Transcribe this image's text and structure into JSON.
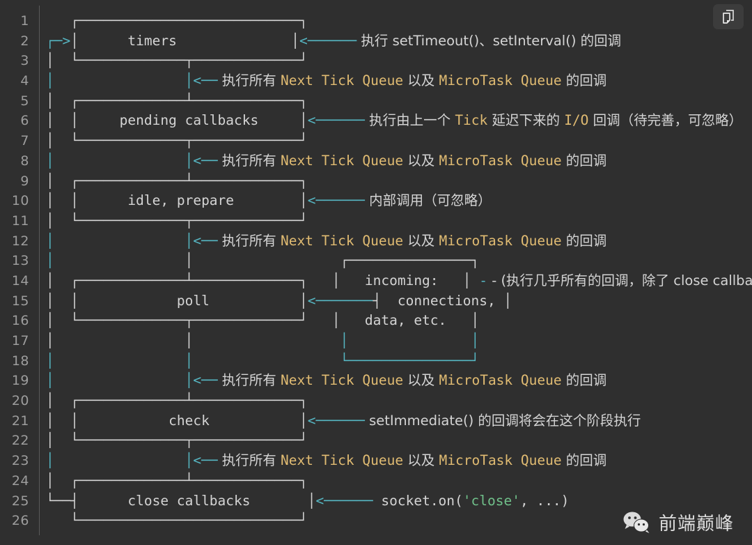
{
  "window": {
    "background": "#2f2f2f",
    "foreground": "#d4d4d4",
    "accent_teal": "#56b6c2",
    "accent_yellow": "#e0bb72",
    "accent_green": "#70c08a",
    "gutter_color": "#9d9d9d"
  },
  "toolbar": {
    "copy_label": "copy-code"
  },
  "gutter": {
    "line_numbers": [
      "1",
      "2",
      "3",
      "4",
      "5",
      "6",
      "7",
      "8",
      "9",
      "10",
      "11",
      "12",
      "13",
      "14",
      "15",
      "16",
      "17",
      "18",
      "19",
      "20",
      "21",
      "22",
      "23",
      "24",
      "25",
      "26"
    ]
  },
  "phases": {
    "timers": "timers",
    "pending_callbacks": "pending callbacks",
    "idle_prepare": "idle, prepare",
    "poll": "poll",
    "check": "check",
    "close_callbacks": "close callbacks",
    "incoming_1": "incoming:",
    "incoming_2": "connections,",
    "incoming_3": "data, etc."
  },
  "annotations": {
    "timers_note": "执行 setTimeout()、setInterval() 的回调",
    "tick_note_prefix": "执行所有 ",
    "tick_note_queue1": "Next Tick Queue",
    "tick_note_mid": " 以及 ",
    "tick_note_queue2": "MicroTask Queue",
    "tick_note_suffix": " 的回调",
    "pending_note_a": "执行由上一个 ",
    "pending_note_tick": "Tick",
    "pending_note_b": " 延迟下来的 ",
    "pending_note_io": "I/O",
    "pending_note_c": " 回调（待完善，可忽略）",
    "idle_note": "内部调用（可忽略）",
    "poll_note": "- (执行几乎所有的回调，除了 close callbac",
    "check_note": "setImmediate() 的回调将会在这个阶段执行",
    "close_note_call": "socket.on(",
    "close_note_arg": "'close'",
    "close_note_tail": ", ...)"
  },
  "ascii": {
    "l1": "   ┌───────────────────────────┐",
    "l3": "│  └─────────────┬─────────────┘",
    "l5": "│  ┌─────────────┴─────────────┐",
    "l7": "│  └─────────────┬─────────────┘",
    "l9": "│  ┌─────────────┴─────────────┐",
    "l11": "│  └─────────────┬─────────────┘",
    "l13": "│                │",
    "l16": "│  └─────────────┬─────────────┘",
    "l17": "│                │",
    "l18": "│                │",
    "l20": "│  ┌─────────────┴─────────────┐",
    "l22": "│  └─────────────┬─────────────┘",
    "l24": "│  ┌─────────────┴─────────────┐",
    "l26": "   └───────────────────────────┘",
    "arrow_in": "┌─>",
    "pipe": "│",
    "box_side": "│",
    "arrow_long": "<──────",
    "arrow_short": "<──",
    "arrow_poll": "<───────"
  },
  "watermark": {
    "icon": "wechat-icon",
    "text": "前端巅峰"
  }
}
